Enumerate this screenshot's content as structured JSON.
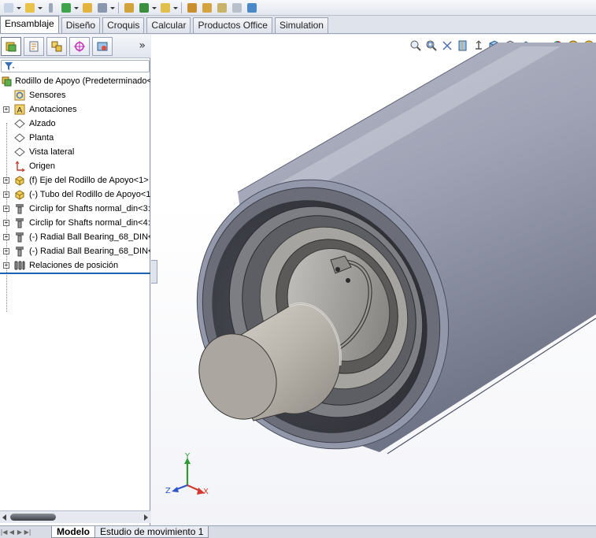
{
  "command_tabs": [
    "Ensamblaje",
    "Diseño",
    "Croquis",
    "Calcular",
    "Productos Office",
    "Simulation"
  ],
  "active_command_tab": "Ensamblaje",
  "tree": {
    "root": "Rodillo de Apoyo  (Predeterminado<",
    "items": [
      {
        "label": "Sensores",
        "icon": "sensor-icon",
        "expandable": false
      },
      {
        "label": "Anotaciones",
        "icon": "annotation-icon",
        "expandable": true
      },
      {
        "label": "Alzado",
        "icon": "plane-icon",
        "expandable": false
      },
      {
        "label": "Planta",
        "icon": "plane-icon",
        "expandable": false
      },
      {
        "label": "Vista lateral",
        "icon": "plane-icon",
        "expandable": false
      },
      {
        "label": "Origen",
        "icon": "origin-icon",
        "expandable": false
      },
      {
        "label": "(f) Eje del Rodillo de Apoyo<1>",
        "icon": "part-icon",
        "expandable": true
      },
      {
        "label": "(-) Tubo del Rodillo de Apoyo<1",
        "icon": "part-icon",
        "expandable": true
      },
      {
        "label": "Circlip for Shafts normal_din<3:",
        "icon": "toolbox-part-icon",
        "expandable": true
      },
      {
        "label": "Circlip for Shafts normal_din<4:",
        "icon": "toolbox-part-icon",
        "expandable": true
      },
      {
        "label": "(-) Radial Ball Bearing_68_DIN<",
        "icon": "toolbox-part-icon",
        "expandable": true
      },
      {
        "label": "(-) Radial Ball Bearing_68_DIN<",
        "icon": "toolbox-part-icon",
        "expandable": true
      },
      {
        "label": "Relaciones de posición",
        "icon": "mates-icon",
        "expandable": true
      }
    ]
  },
  "bottom_tabs": [
    "Modelo",
    "Estudio de movimiento 1"
  ],
  "active_bottom_tab": "Modelo",
  "triad": {
    "x": "X",
    "y": "Y",
    "z": "Z"
  },
  "colors": {
    "accent": "#1c63b4",
    "tube": "#8e92a6",
    "shaft": "#bdb9b3"
  }
}
